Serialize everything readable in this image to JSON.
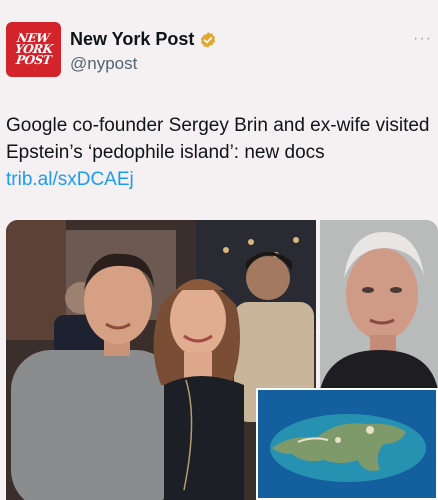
{
  "account": {
    "logo_lines": [
      "NEW",
      "YORK",
      "POST"
    ],
    "display_name": "New York Post",
    "handle": "@nypost",
    "verified": true,
    "verified_color": "#e0a82e",
    "more_label": "···"
  },
  "tweet": {
    "text": "Google co-founder Sergey Brin and ex-wife visited Epstein’s ‘pedophile island’: new docs",
    "link": "trib.al/sxDCAEj"
  },
  "media": {
    "photos": [
      "couple-photo",
      "mugshot-photo",
      "island-aerial-photo"
    ]
  },
  "colors": {
    "brand_red": "#d3242c",
    "link_blue": "#1d9bf0",
    "handle_gray": "#536471"
  }
}
